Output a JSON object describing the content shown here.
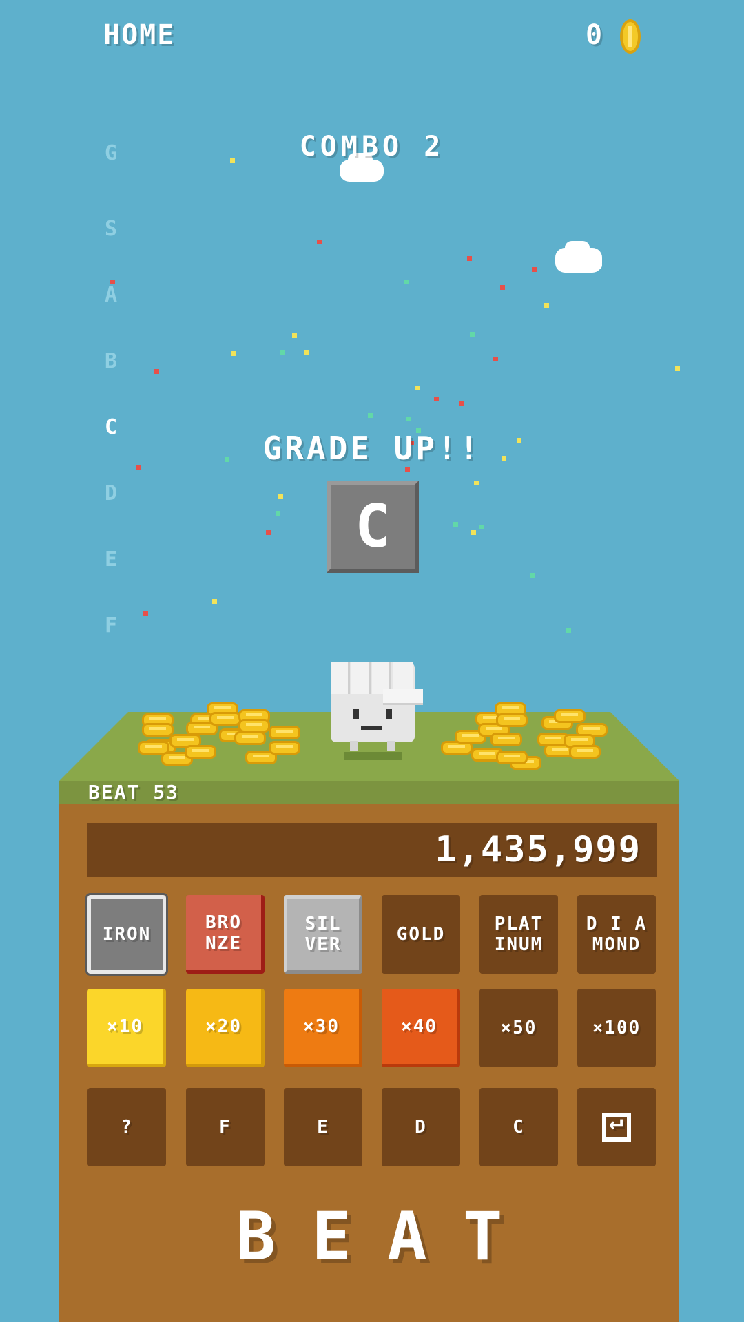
{
  "header": {
    "home_label": "HOME",
    "coins": "0"
  },
  "combo_label": "COMBO 2",
  "grade_scale": [
    "G",
    "S",
    "A",
    "B",
    "C",
    "D",
    "E",
    "F"
  ],
  "active_grade": "C",
  "grade_up_label": "GRADE UP!!",
  "current_grade": "C",
  "beat_count_label": "BEAT 53",
  "score": "1,435,999",
  "material_tiles": [
    {
      "label": "IRON",
      "style": "iron"
    },
    {
      "label": "BRO\nNZE",
      "style": "bronze"
    },
    {
      "label": "SIL\nVER",
      "style": "silver"
    },
    {
      "label": "GOLD",
      "style": "dark"
    },
    {
      "label": "PLAT\nINUM",
      "style": "dark"
    },
    {
      "label": "D I A\nMOND",
      "style": "dark"
    }
  ],
  "multiplier_tiles": [
    {
      "label": "×10",
      "style": "m10"
    },
    {
      "label": "×20",
      "style": "m20"
    },
    {
      "label": "×30",
      "style": "m30"
    },
    {
      "label": "×40",
      "style": "m40"
    },
    {
      "label": "×50",
      "style": "dark"
    },
    {
      "label": "×100",
      "style": "dark"
    }
  ],
  "grade_tiles": [
    {
      "label": "?",
      "style": "dark"
    },
    {
      "label": "F",
      "style": "dark"
    },
    {
      "label": "E",
      "style": "dark"
    },
    {
      "label": "D",
      "style": "dark"
    },
    {
      "label": "C",
      "style": "dark"
    },
    {
      "label": "",
      "style": "dark",
      "icon": "back-icon"
    }
  ],
  "beat_button_label": "BEAT",
  "colors": {
    "sky": "#5eb0cc",
    "grass": "#8aa84a",
    "dirt": "#a86e2c",
    "panel": "#72441a"
  }
}
